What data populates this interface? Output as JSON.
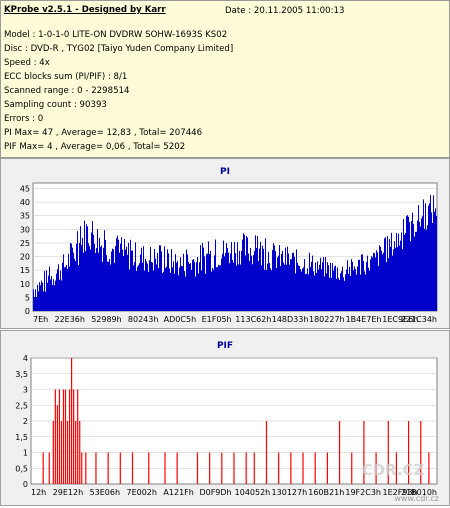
{
  "info": {
    "title": "KProbe v2.5.1 - Designed by Karr",
    "date": "Date : 20.11.2005 11:00:13",
    "lines": [
      "Model : 1-0-1-0 LITE-ON DVDRW SOHW-1693S KS02",
      "Disc : DVD-R , TYG02 [Taiyo Yuden Company Limited]",
      "Speed : 4x",
      "ECC blocks sum (PI/PIF) : 8/1",
      "Scanned range : 0 - 2298514",
      "Sampling count : 90393",
      "Errors : 0",
      "PI Max= 47 , Average= 12,83 , Total= 207446",
      "PIF Max= 4 , Average= 0,06 , Total= 5202"
    ]
  },
  "watermark": "CDR.CZ",
  "watermark_url": "www.cdr.cz",
  "colors": {
    "pi": "#0000cc",
    "pif": "#ff0000",
    "title": "#000099",
    "plot_bg": "#ffffff",
    "grid": "#c8c8c8"
  },
  "chart_data": [
    {
      "type": "bar",
      "title": "PI",
      "ylim": [
        0,
        47
      ],
      "yticks": [
        "0",
        "5",
        "10",
        "15",
        "20",
        "25",
        "30",
        "35",
        "40",
        "45"
      ],
      "ytick_values": [
        0,
        5,
        10,
        15,
        20,
        25,
        30,
        35,
        40,
        45
      ],
      "xtick_labels": [
        "7Eh",
        "22E36h",
        "52989h",
        "80243h",
        "AD0C5h",
        "E1F05h",
        "113C62h",
        "148D33h",
        "180227h",
        "1B4E7Eh",
        "1EC9E6h",
        "221C34h"
      ],
      "envelope_x": [
        0,
        0.03,
        0.08,
        0.12,
        0.13,
        0.15,
        0.17,
        0.22,
        0.27,
        0.32,
        0.37,
        0.42,
        0.47,
        0.52,
        0.57,
        0.62,
        0.67,
        0.72,
        0.77,
        0.8,
        0.84,
        0.88,
        0.92,
        0.96,
        1.0
      ],
      "envelope_max": [
        12,
        15,
        22,
        32,
        36,
        35,
        30,
        27,
        25,
        24,
        22,
        25,
        27,
        29,
        27,
        24,
        22,
        20,
        18,
        20,
        22,
        28,
        34,
        40,
        45
      ],
      "envelope_typical": [
        4,
        6,
        12,
        18,
        22,
        21,
        18,
        15,
        14,
        13,
        12,
        13,
        16,
        17,
        15,
        14,
        13,
        12,
        10,
        12,
        14,
        18,
        23,
        28,
        32
      ],
      "max": 47,
      "average": 12.83
    },
    {
      "type": "bar",
      "title": "PIF",
      "ylim": [
        0,
        4
      ],
      "yticks": [
        "0",
        "0,5",
        "1",
        "1,5",
        "2",
        "2,5",
        "3",
        "3,5",
        "4"
      ],
      "ytick_values": [
        0,
        0.5,
        1,
        1.5,
        2,
        2.5,
        3,
        3.5,
        4
      ],
      "xtick_labels": [
        "12h",
        "29E12h",
        "53E06h",
        "7E002h",
        "A121Fh",
        "D0F9Dh",
        "104052h",
        "130127h",
        "160B21h",
        "19F2C3h",
        "1E2F93h",
        "21B010h"
      ],
      "spikes": [
        {
          "x": 0.03,
          "v": 1
        },
        {
          "x": 0.045,
          "v": 1
        },
        {
          "x": 0.055,
          "v": 2
        },
        {
          "x": 0.06,
          "v": 3
        },
        {
          "x": 0.065,
          "v": 2.5
        },
        {
          "x": 0.07,
          "v": 3
        },
        {
          "x": 0.075,
          "v": 2
        },
        {
          "x": 0.08,
          "v": 3
        },
        {
          "x": 0.085,
          "v": 3
        },
        {
          "x": 0.09,
          "v": 2
        },
        {
          "x": 0.095,
          "v": 3
        },
        {
          "x": 0.1,
          "v": 4
        },
        {
          "x": 0.105,
          "v": 3
        },
        {
          "x": 0.11,
          "v": 2
        },
        {
          "x": 0.115,
          "v": 3
        },
        {
          "x": 0.12,
          "v": 2
        },
        {
          "x": 0.125,
          "v": 1
        },
        {
          "x": 0.135,
          "v": 1
        },
        {
          "x": 0.16,
          "v": 1
        },
        {
          "x": 0.19,
          "v": 1
        },
        {
          "x": 0.22,
          "v": 1
        },
        {
          "x": 0.25,
          "v": 1
        },
        {
          "x": 0.29,
          "v": 1
        },
        {
          "x": 0.33,
          "v": 1
        },
        {
          "x": 0.36,
          "v": 1
        },
        {
          "x": 0.41,
          "v": 1
        },
        {
          "x": 0.44,
          "v": 1
        },
        {
          "x": 0.47,
          "v": 1
        },
        {
          "x": 0.5,
          "v": 1
        },
        {
          "x": 0.53,
          "v": 1
        },
        {
          "x": 0.55,
          "v": 1
        },
        {
          "x": 0.58,
          "v": 2
        },
        {
          "x": 0.61,
          "v": 1
        },
        {
          "x": 0.64,
          "v": 1
        },
        {
          "x": 0.67,
          "v": 1
        },
        {
          "x": 0.7,
          "v": 1
        },
        {
          "x": 0.73,
          "v": 1
        },
        {
          "x": 0.76,
          "v": 2
        },
        {
          "x": 0.79,
          "v": 1
        },
        {
          "x": 0.82,
          "v": 2
        },
        {
          "x": 0.85,
          "v": 1
        },
        {
          "x": 0.88,
          "v": 2
        },
        {
          "x": 0.9,
          "v": 1
        },
        {
          "x": 0.93,
          "v": 2
        },
        {
          "x": 0.96,
          "v": 2
        },
        {
          "x": 0.98,
          "v": 1
        }
      ],
      "max": 4,
      "average": 0.06
    }
  ]
}
